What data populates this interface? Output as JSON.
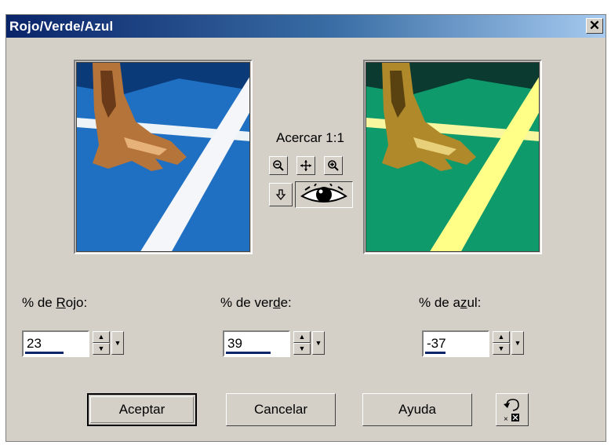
{
  "window": {
    "title": "Rojo/Verde/Azul",
    "close_label": "✕"
  },
  "preview": {
    "zoom_label": "Acercar 1:1"
  },
  "toolbar": {
    "zoom_out_icon": "magnifier-minus-icon",
    "pan_icon": "move-icon",
    "zoom_in_icon": "magnifier-plus-icon",
    "apply_icon": "arrow-down-icon",
    "proof_icon": "eye-icon"
  },
  "controls": {
    "red": {
      "label_prefix": "% de ",
      "mnemonic": "R",
      "label_suffix": "ojo:",
      "value": "23",
      "fill": 0.6
    },
    "green": {
      "label_prefix": "% de ver",
      "mnemonic": "d",
      "label_suffix": "e:",
      "value": "39",
      "fill": 0.69
    },
    "blue": {
      "label_prefix": "% de a",
      "mnemonic": "z",
      "label_suffix": "ul:",
      "value": "-37",
      "fill": 0.32
    }
  },
  "buttons": {
    "ok": "Aceptar",
    "cancel": "Cancelar",
    "help": "Ayuda",
    "reset_icon": "reset-defaults-icon"
  },
  "colors": {
    "title_start": "#0a246a",
    "title_end": "#a6caf0",
    "dialog_bg": "#d4d0c8",
    "before_court": "#1f6fc2",
    "after_court": "#0e9a6a",
    "after_line": "#ffff88"
  }
}
